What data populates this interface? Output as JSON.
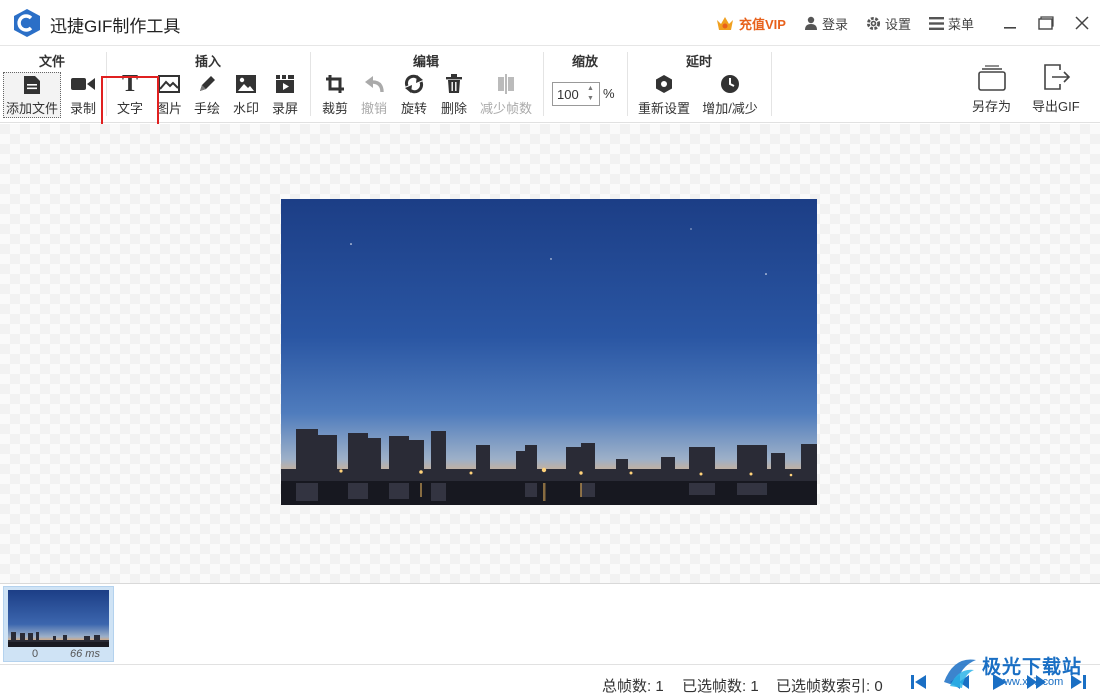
{
  "app": {
    "title": "迅捷GIF制作工具"
  },
  "titlebar": {
    "vip_label": "充值VIP",
    "login_label": "登录",
    "settings_label": "设置",
    "menu_label": "菜单"
  },
  "ribbon": {
    "file": {
      "title": "文件",
      "add_file": "添加文件",
      "record": "录制"
    },
    "insert": {
      "title": "插入",
      "text": "文字",
      "image": "图片",
      "draw": "手绘",
      "watermark": "水印",
      "screen_record": "录屏"
    },
    "edit": {
      "title": "编辑",
      "crop": "裁剪",
      "undo": "撤销",
      "rotate": "旋转",
      "delete": "删除",
      "reduce_frames": "减少帧数"
    },
    "zoom": {
      "title": "缩放",
      "value": "100",
      "unit": "%"
    },
    "delay": {
      "title": "延时",
      "reset": "重新设置",
      "adjust": "增加/减少"
    },
    "save_as": "另存为",
    "export_gif": "导出GIF"
  },
  "filmstrip": {
    "frames": [
      {
        "index": "0",
        "duration": "66 ms"
      }
    ]
  },
  "status": {
    "total_frames": "总帧数: 1",
    "selected_frames": "已选帧数: 1",
    "selected_index": "已选帧数索引: 0"
  },
  "watermark_brand": {
    "name": "极光下载站",
    "url": "www.xz7.com"
  },
  "colors": {
    "accent": "#1a6fc4",
    "vip": "#e8611c",
    "highlight": "#e02020"
  }
}
